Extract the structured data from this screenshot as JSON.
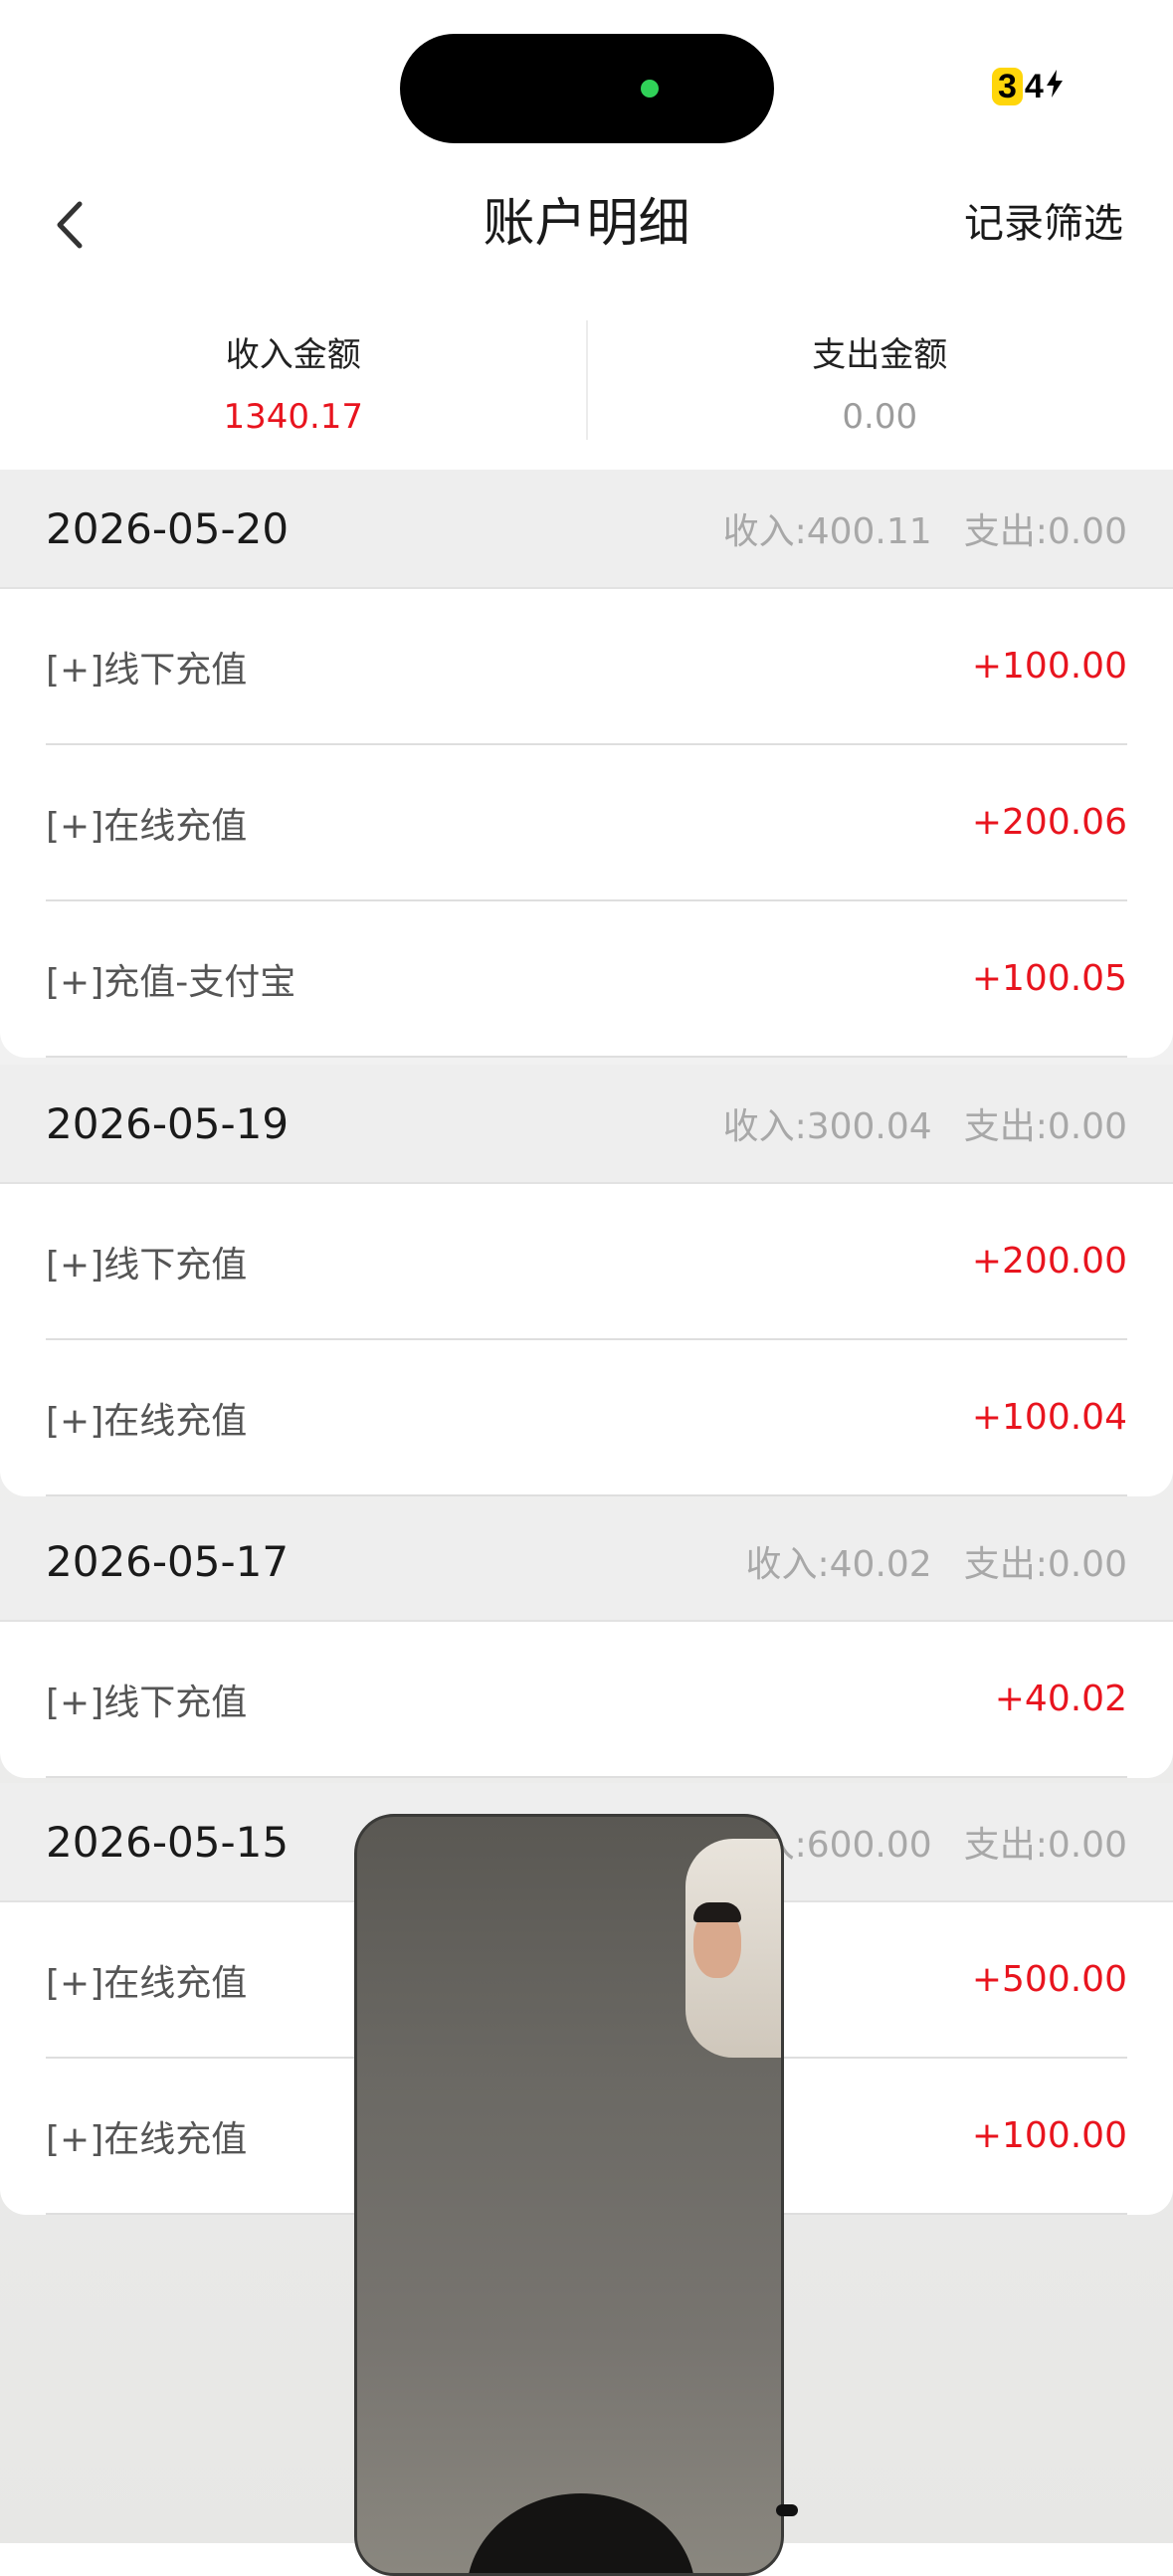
{
  "status_bar": {
    "battery_level": "3",
    "battery_rest": "4",
    "charging_icon": "bolt-icon"
  },
  "nav": {
    "back_icon": "chevron-left-icon",
    "title": "账户明细",
    "filter_label": "记录筛选"
  },
  "summary": {
    "income_label": "收入金额",
    "income_value": "1340.17",
    "expense_label": "支出金额",
    "expense_value": "0.00",
    "colors": {
      "income": "#e8141e",
      "expense": "#9c9c9c"
    }
  },
  "groups": [
    {
      "date": "2026-05-20",
      "income": "收入:400.11",
      "expense": "支出:0.00",
      "rows": [
        {
          "label": "[+]线下充值",
          "amount": "+100.00"
        },
        {
          "label": "[+]在线充值",
          "amount": "+200.06"
        },
        {
          "label": "[+]充值-支付宝",
          "amount": "+100.05"
        }
      ]
    },
    {
      "date": "2026-05-19",
      "income": "收入:300.04",
      "expense": "支出:0.00",
      "rows": [
        {
          "label": "[+]线下充值",
          "amount": "+200.00"
        },
        {
          "label": "[+]在线充值",
          "amount": "+100.04"
        }
      ]
    },
    {
      "date": "2026-05-17",
      "income": "收入:40.02",
      "expense": "支出:0.00",
      "rows": [
        {
          "label": "[+]线下充值",
          "amount": "+40.02"
        }
      ]
    },
    {
      "date": "2026-05-15",
      "income": "收入:600.00",
      "expense": "支出:0.00",
      "rows": [
        {
          "label": "[+]在线充值",
          "amount": "+500.00"
        },
        {
          "label": "[+]在线充值",
          "amount": "+100.00"
        }
      ]
    }
  ]
}
